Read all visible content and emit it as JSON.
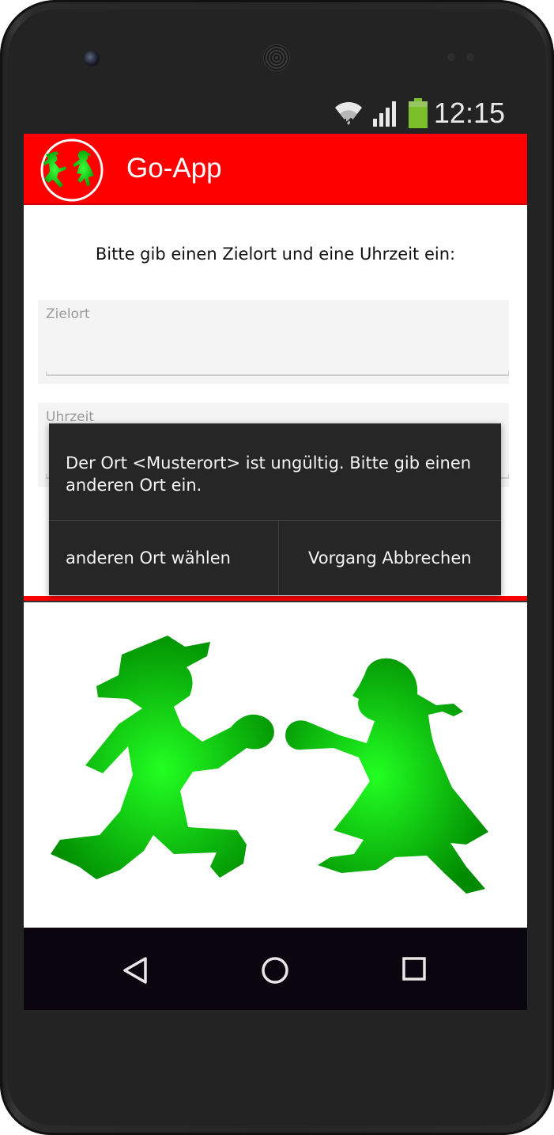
{
  "status_bar": {
    "time": "12:15",
    "icons": [
      "wifi-icon",
      "signal-icon",
      "battery-icon"
    ],
    "battery_color": "#7bbf2a"
  },
  "app_bar": {
    "title": "Go-App",
    "logo": "ampelmaennchen-logo",
    "background": "#ff0000"
  },
  "form": {
    "prompt": "Bitte gib einen Zielort und eine Uhrzeit ein:",
    "destination_label": "Zielort",
    "time_label": "Uhrzeit"
  },
  "dialog": {
    "message": "Der Ort <Musterort> ist ungültig. Bitte gib einen anderen Ort ein.",
    "choose_other_label": "anderen Ort wählen",
    "cancel_label": "Vorgang Abbrechen"
  },
  "illustration": {
    "subject": "ampelmaennchen-walking-pair",
    "color": "#00d000"
  },
  "nav_bar": {
    "icons": [
      "back-icon",
      "home-icon",
      "recents-icon"
    ]
  }
}
